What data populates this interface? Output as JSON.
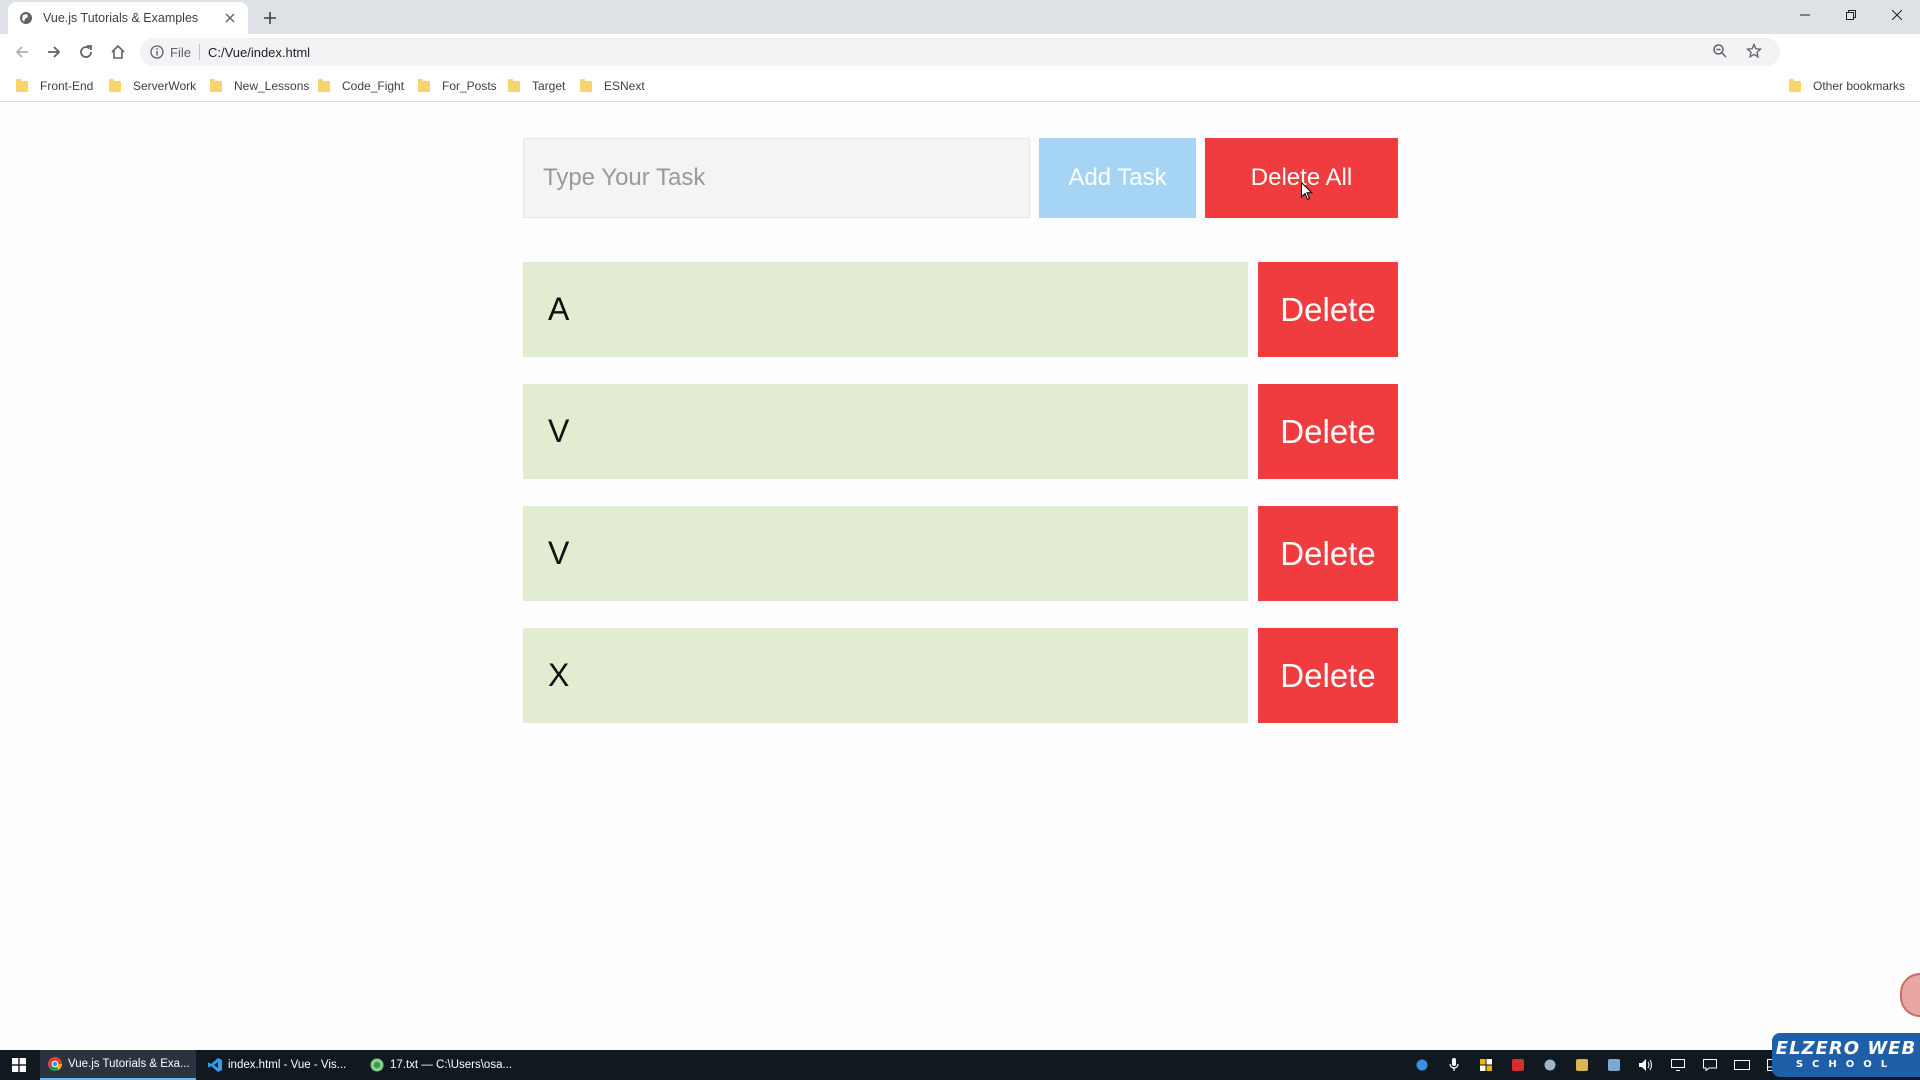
{
  "browser": {
    "tab_title": "Vue.js Tutorials & Examples",
    "omnibox_scheme": "File",
    "url": "C:/Vue/index.html",
    "bookmarks": [
      "Front-End",
      "ServerWork",
      "New_Lessons",
      "Code_Fight",
      "For_Posts",
      "Target",
      "ESNext"
    ],
    "other_bookmarks": "Other bookmarks"
  },
  "app": {
    "input_placeholder": "Type Your Task",
    "add_button": "Add Task",
    "delete_all_button": "Delete All",
    "tasks": [
      {
        "text": "A",
        "delete_label": "Delete"
      },
      {
        "text": "V",
        "delete_label": "Delete"
      },
      {
        "text": "V",
        "delete_label": "Delete"
      },
      {
        "text": "X",
        "delete_label": "Delete"
      }
    ]
  },
  "taskbar": {
    "items": [
      "Vue.js Tutorials & Exa...",
      "index.html - Vue - Vis...",
      "17.txt — C:\\Users\\osa..."
    ]
  },
  "watermark": {
    "line1": "ELZERO WEB",
    "line2": "SCHOOL"
  },
  "colors": {
    "add_button": "#a6d4f5",
    "delete_button": "#f03b3f",
    "task_background": "#e1ecd0"
  }
}
